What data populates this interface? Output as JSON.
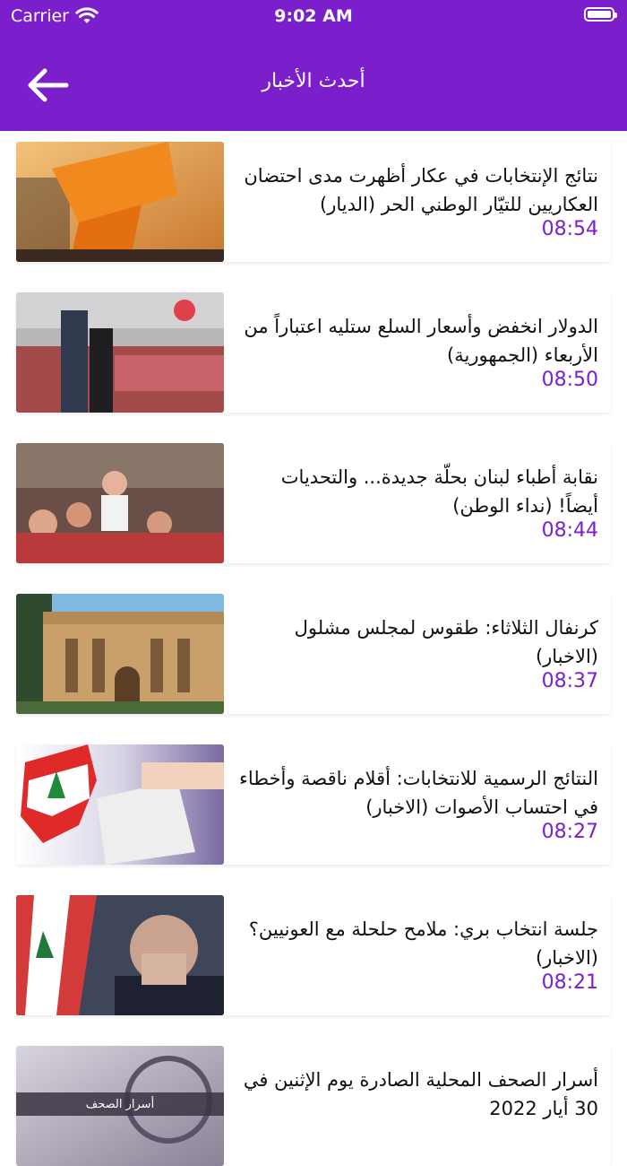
{
  "status_bar": {
    "carrier": "Carrier",
    "time": "9:02 AM"
  },
  "nav": {
    "title": "أحدث الأخبار",
    "back_icon": "arrow-left-icon"
  },
  "colors": {
    "primary": "#7b1fcc",
    "time_text": "#7b1fcc"
  },
  "articles": [
    {
      "title": "نتائج الإنتخابات في عكار أظهرت مدى احتضان العكاريين للتيّار الوطني الحر (الديار)",
      "time": "08:54"
    },
    {
      "title": "الدولار انخفض وأسعار السلع ستليه اعتباراً من الأربعاء (الجمهورية)",
      "time": "08:50"
    },
    {
      "title": "نقابة أطباء لبنان بحلّة جديدة... والتحديات أيضاً! (نداء الوطن)",
      "time": "08:44"
    },
    {
      "title": "كرنفال الثلاثاء: طقوس لمجلس مشلول (الاخبار)",
      "time": "08:37"
    },
    {
      "title": "النتائج الرسمية للانتخابات: أقلام ناقصة وأخطاء في احتساب الأصوات (الاخبار)",
      "time": "08:27"
    },
    {
      "title": "جلسة انتخاب بري: ملامح حلحلة مع العونيين؟ (الاخبار)",
      "time": "08:21"
    },
    {
      "title": "أسرار الصحف المحلية الصادرة يوم الإثنين في 30 أيار 2022",
      "time": "",
      "thumb_caption": "أسرار الصحف"
    }
  ]
}
